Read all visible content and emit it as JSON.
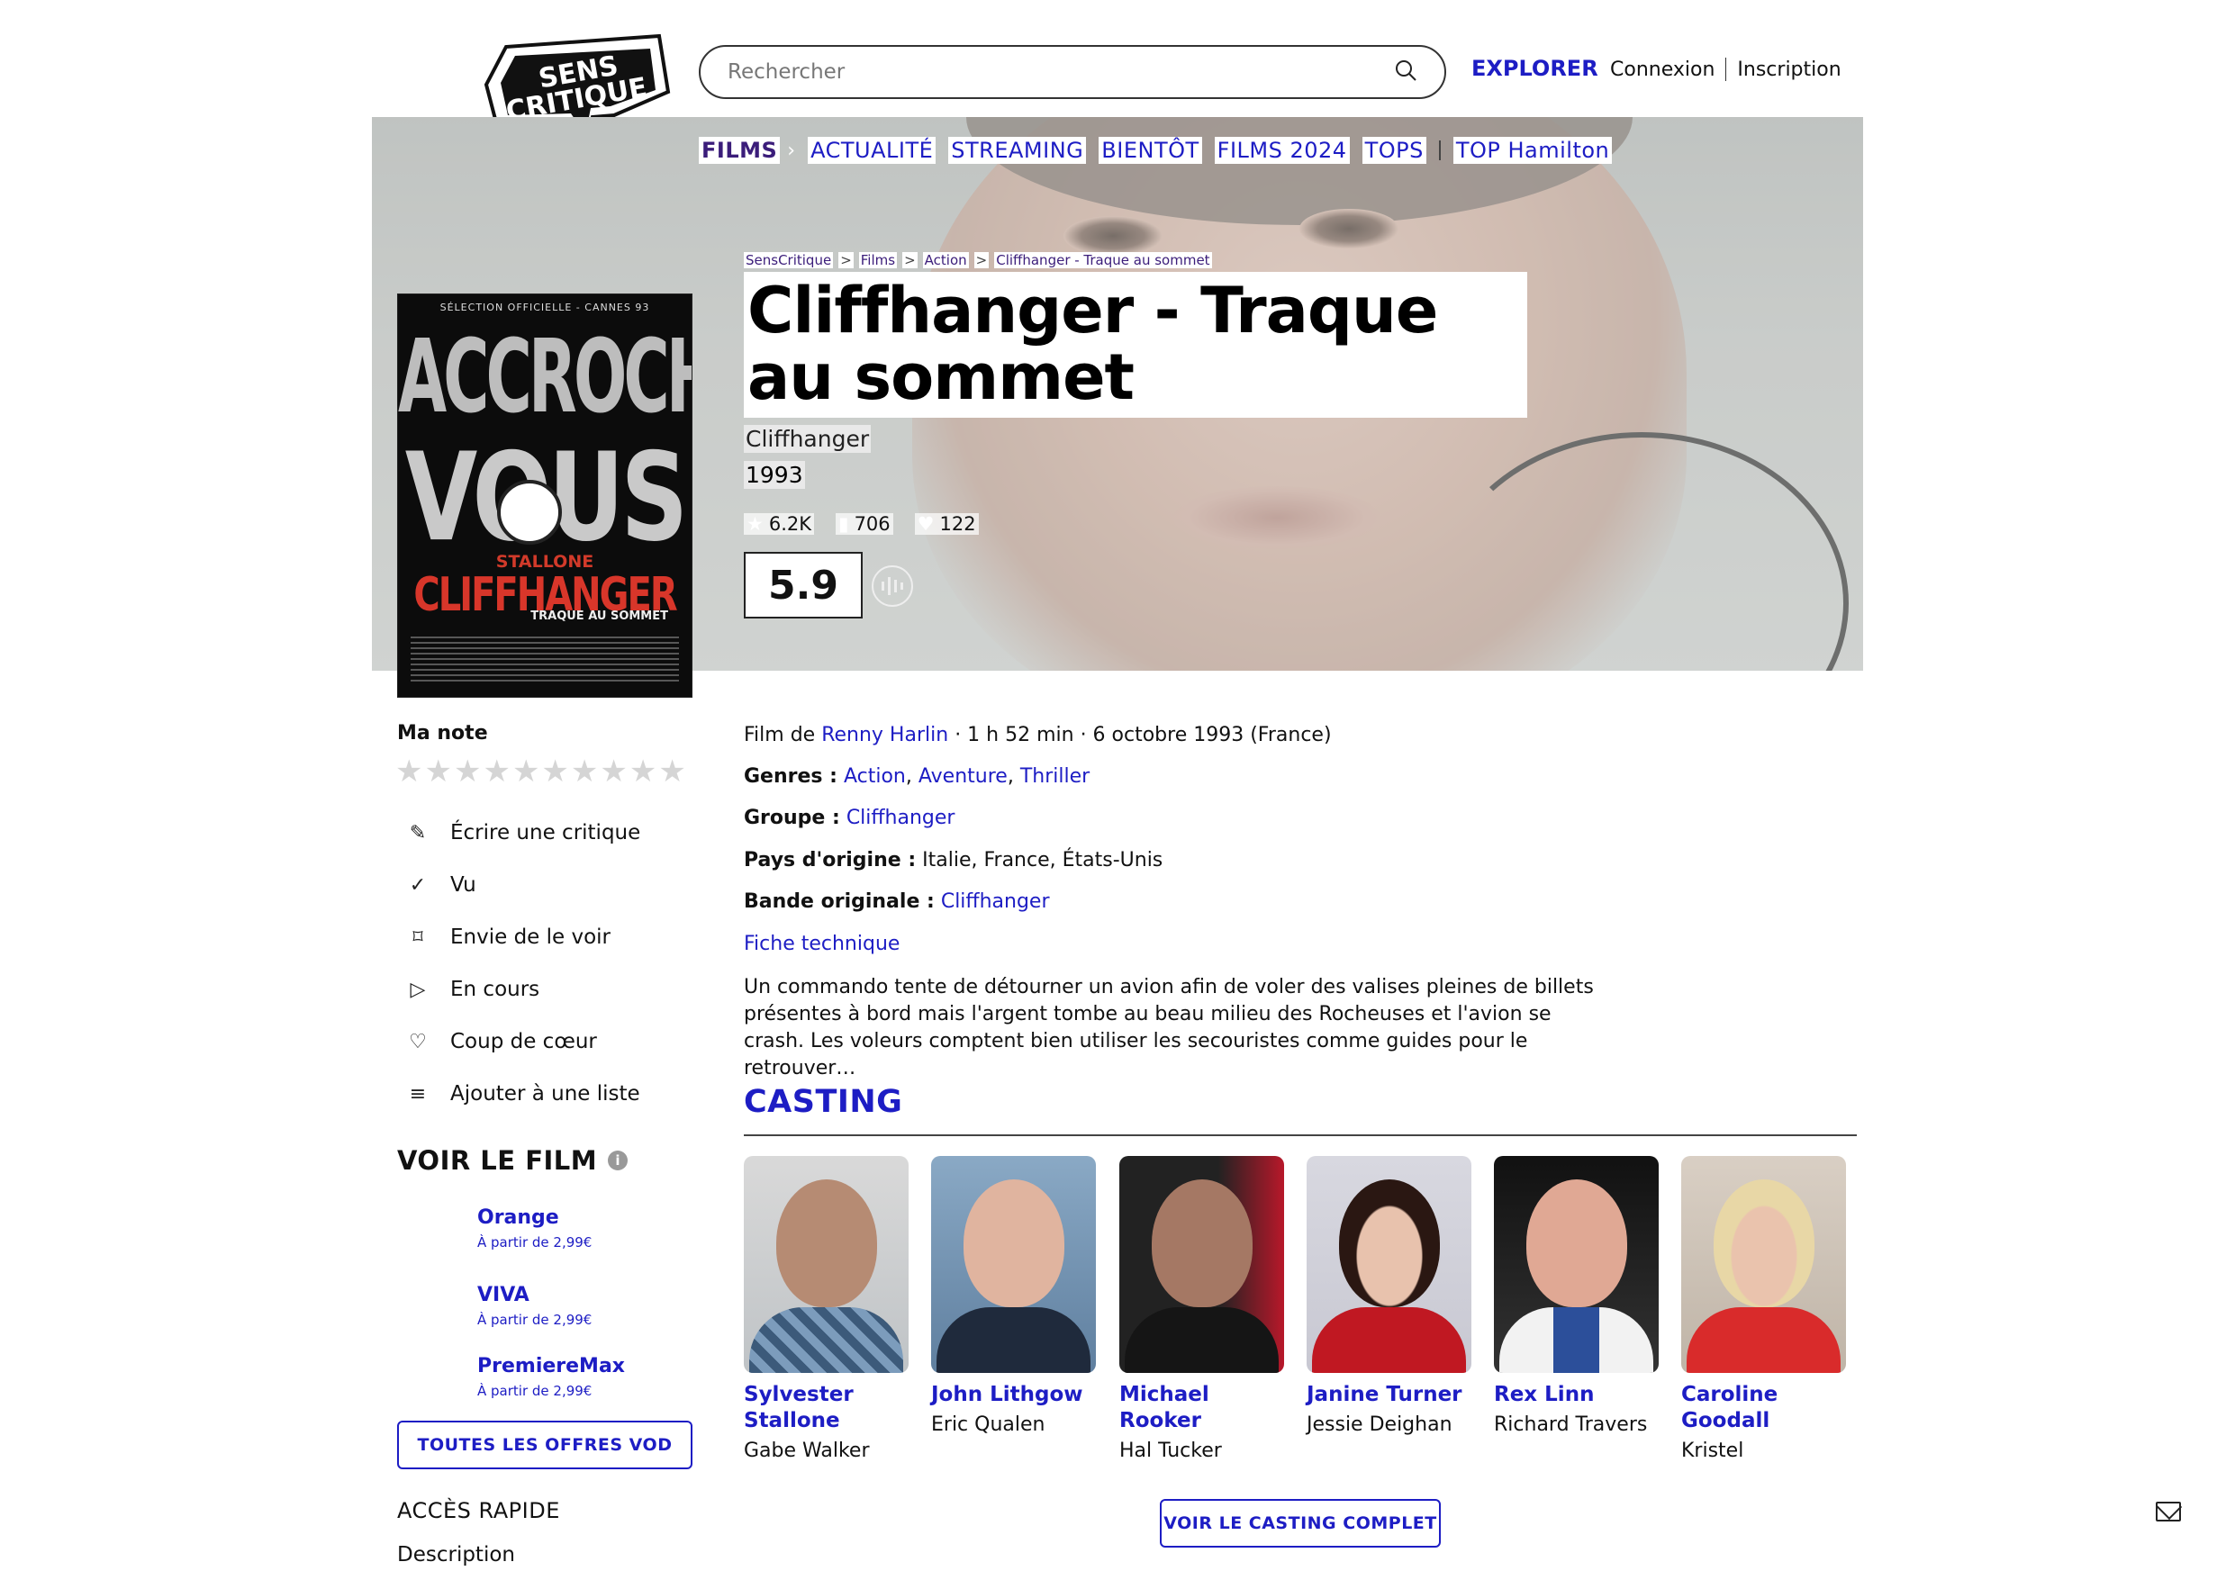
{
  "header": {
    "logo_line1": "SENS",
    "logo_line2": "CRITIQUE",
    "search_placeholder": "Rechercher",
    "explore": "EXPLORER",
    "login": "Connexion",
    "signup": "Inscription"
  },
  "nav": {
    "items": [
      "FILMS",
      "ACTUALITÉ",
      "STREAMING",
      "BIENTÔT",
      "FILMS 2024",
      "TOPS",
      "TOP Hamilton"
    ]
  },
  "breadcrumb": [
    "SensCritique",
    "Films",
    "Action",
    "Cliffhanger - Traque au sommet"
  ],
  "movie": {
    "title": "Cliffhanger - Traque au sommet",
    "original_title": "Cliffhanger",
    "year": "1993",
    "ratings_count": "6.2K",
    "wishlist_count": "706",
    "favorites_count": "122",
    "score": "5.9",
    "poster": {
      "top": "SÉLECTION OFFICIELLE - CANNES 93",
      "line1": "ACCROCHEZ",
      "line2": "VOUS",
      "star": "STALLONE",
      "film": "CLIFFHANGER",
      "subtitle": "TRAQUE AU SOMMET"
    }
  },
  "left": {
    "my_rating_label": "Ma note",
    "stars": [
      "★",
      "★",
      "★",
      "★",
      "★",
      "★",
      "★",
      "★",
      "★",
      "★"
    ],
    "actions": [
      {
        "label": "Écrire une critique",
        "icon": "pencil-icon",
        "glyph": "✎"
      },
      {
        "label": "Vu",
        "icon": "check-icon",
        "glyph": "✓"
      },
      {
        "label": "Envie de le voir",
        "icon": "bookmark-icon",
        "glyph": "⌑"
      },
      {
        "label": "En cours",
        "icon": "play-icon",
        "glyph": "▷"
      },
      {
        "label": "Coup de cœur",
        "icon": "heart-icon",
        "glyph": "♡"
      },
      {
        "label": "Ajouter à une liste",
        "icon": "list-add-icon",
        "glyph": "≡"
      }
    ],
    "watch_title": "VOIR LE FILM",
    "vod": [
      {
        "name": "Orange",
        "price": "À partir de 2,99€"
      },
      {
        "name": "VIVA",
        "price": "À partir de 2,99€"
      },
      {
        "name": "PremiereMax",
        "price": "À partir de 2,99€"
      }
    ],
    "all_vod": "TOUTES LES OFFRES VOD",
    "quick_access": "ACCÈS RAPIDE",
    "description_link": "Description"
  },
  "details": {
    "film_by_label": "Film de",
    "director": "Renny Harlin",
    "duration_date": "· 1 h 52 min · 6 octobre 1993 (France)",
    "genres_label": "Genres :",
    "genres": [
      "Action",
      "Aventure",
      "Thriller"
    ],
    "group_label": "Groupe :",
    "group": "Cliffhanger",
    "country_label": "Pays d'origine :",
    "country": "Italie, France, États-Unis",
    "soundtrack_label": "Bande originale :",
    "soundtrack": "Cliffhanger",
    "tech_sheet": "Fiche technique",
    "synopsis": "Un commando tente de détourner un avion afin de voler des valises pleines de billets présentes à bord mais l'argent tombe au beau milieu des Rocheuses et l'avion se crash. Les voleurs comptent bien utiliser les secouristes comme guides pour le retrouver…"
  },
  "casting": {
    "title": "CASTING",
    "full_cast_button": "VOIR LE CASTING COMPLET",
    "cast": [
      {
        "name": "Sylvester Stallone",
        "role": "Gabe Walker"
      },
      {
        "name": "John Lithgow",
        "role": "Eric Qualen"
      },
      {
        "name": "Michael Rooker",
        "role": "Hal Tucker"
      },
      {
        "name": "Janine Turner",
        "role": "Jessie Deighan"
      },
      {
        "name": "Rex Linn",
        "role": "Richard Travers"
      },
      {
        "name": "Caroline Goodall",
        "role": "Kristel"
      }
    ]
  },
  "colors": {
    "accent": "#1d1dc4",
    "active_nav": "#3b1d7a"
  }
}
